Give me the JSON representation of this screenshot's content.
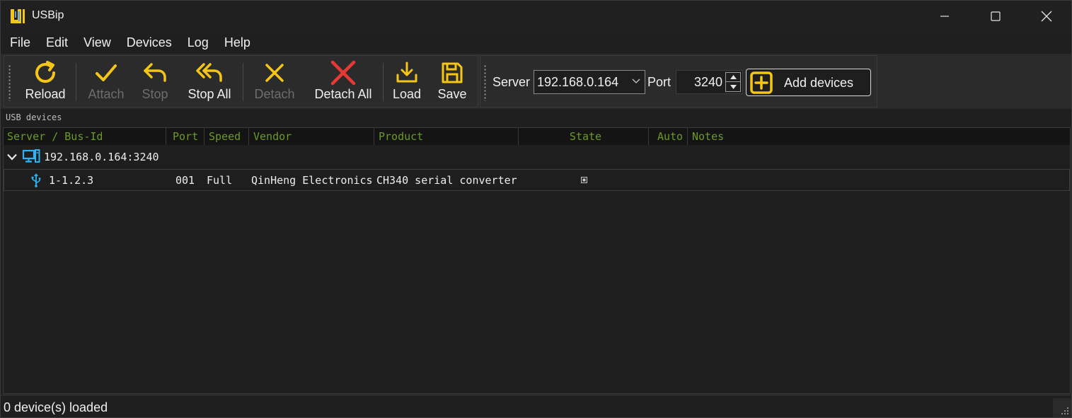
{
  "window": {
    "title": "USBip",
    "logo_colors": {
      "primary": "#f5c518",
      "secondary": "#5aa0e0"
    }
  },
  "menu": [
    "File",
    "Edit",
    "View",
    "Devices",
    "Log",
    "Help"
  ],
  "toolbar": {
    "reload": "Reload",
    "attach": "Attach",
    "stop": "Stop",
    "stop_all": "Stop All",
    "detach": "Detach",
    "detach_all": "Detach All",
    "load": "Load",
    "save": "Save"
  },
  "connection": {
    "server_label": "Server",
    "server_value": "192.168.0.164",
    "port_label": "Port",
    "port_value": "3240",
    "add_devices": "Add devices"
  },
  "section_label": "USB devices",
  "tree": {
    "columns": [
      "Server / Bus-Id",
      "Port",
      "Speed",
      "Vendor",
      "Product",
      "State",
      "Auto",
      "Notes"
    ],
    "server": "192.168.0.164:3240",
    "devices": [
      {
        "bus_id": "1-1.2.3",
        "port": "001",
        "speed": "Full",
        "vendor": "QinHeng Electronics",
        "product": "CH340 serial converter",
        "state": "",
        "auto": "",
        "notes": ""
      }
    ]
  },
  "status": "0 device(s) loaded",
  "colors": {
    "accent": "#f5c518",
    "danger": "#e53935",
    "header_text": "#6a9a28",
    "server_icon": "#29b6f6"
  }
}
